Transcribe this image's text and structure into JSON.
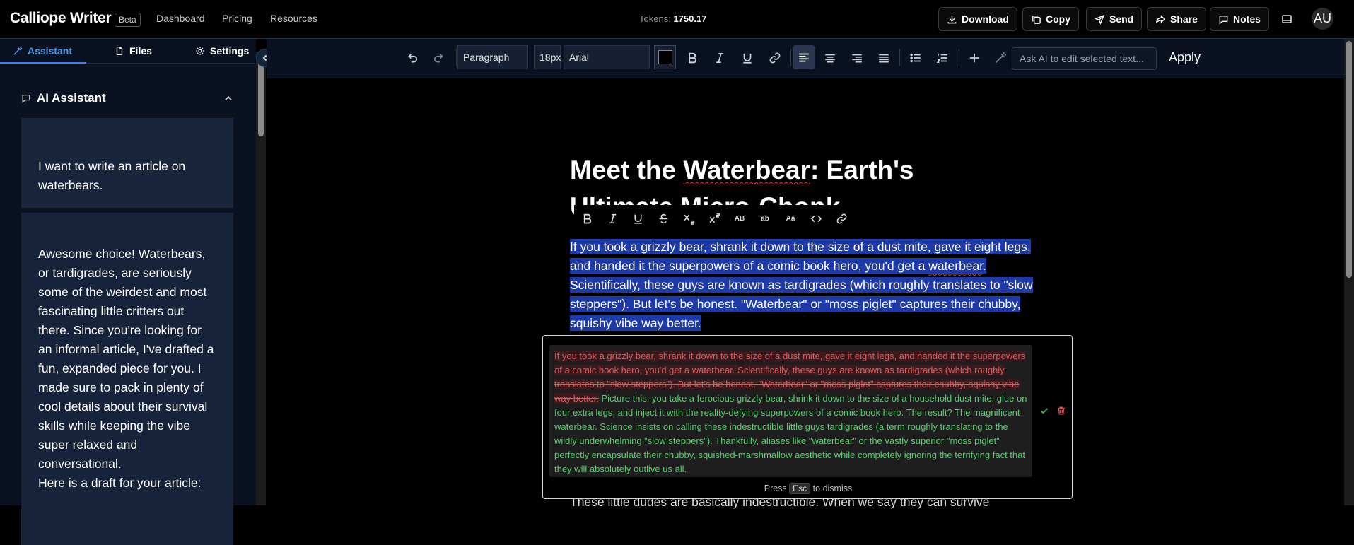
{
  "app": {
    "brand": "Calliope Writer",
    "badge": "Beta",
    "nav": [
      "Dashboard",
      "Pricing",
      "Resources"
    ],
    "tokens_label": "Tokens:",
    "tokens_value": "1750.17",
    "actions": {
      "download": "Download",
      "copy": "Copy",
      "send": "Send",
      "share": "Share",
      "notes": "Notes"
    },
    "avatar_initials": "AU"
  },
  "sidebar": {
    "tabs": [
      "Assistant",
      "Files",
      "Settings"
    ],
    "active_tab": "Assistant",
    "panel_title": "AI Assistant",
    "messages": [
      {
        "role": "user",
        "text": "I want to write an article on waterbears."
      },
      {
        "role": "assistant",
        "text": "Awesome choice! Waterbears, or tardigrades, are seriously some of the weirdest and most fascinating little critters out there. Since you're looking for an informal article, I've drafted a fun, expanded piece for you. I made sure to pack in plenty of cool details about their survival skills while keeping the vibe super relaxed and conversational.",
        "text2": "Here is a draft for your article:"
      }
    ]
  },
  "toolbar": {
    "block_type": "Paragraph",
    "font_size": "18px",
    "font_family": "Arial",
    "text_color": "#000000",
    "ai_placeholder": "Ask AI to edit selected text...",
    "apply_label": "Apply"
  },
  "editor": {
    "title_p1": "Meet the ",
    "title_squig": "Waterbear",
    "title_p2": ": Earth's Ultimate Micro-Chonk",
    "para_p1": "If you took a grizzly bear, shrank it down to the size of a dust mite, gave it eight legs, and handed it the superpowers of a comic book hero, you'd get a ",
    "para_squig": "waterbear",
    "para_p2": ". Scientifically, these guys are known as tardigrades (which roughly translates to \"slow steppers\"). But let's be honest. \"Waterbear\" or \"moss piglet\" captures their chubby, squishy vibe way better.",
    "next_line": "These little dudes are basically indestructible. When we say they can survive"
  },
  "float_toolbar": {
    "superscript_like": [
      "AB",
      "ab",
      "Aa"
    ]
  },
  "diff": {
    "deleted": "If you took a grizzly bear, shrank it down to the size of a dust mite, gave it eight legs, and handed it the superpowers of a comic book hero, you'd get a waterbear. Scientifically, these guys are known as tardigrades (which roughly translates to \"slow steppers\"). But let's be honest. \"Waterbear\" or \"moss piglet\" captures their chubby, squishy vibe way better.",
    "inserted": "Picture this: you take a ferocious grizzly bear, shrink it down to the size of a household dust mite, glue on four extra legs, and inject it with the reality-defying superpowers of a comic book hero. The result? The magnificent waterbear. Science insists on calling these indestructible little guys tardigrades (a term roughly translating to the wildly underwhelming \"slow steppers\"). Thankfully, aliases like \"waterbear\" or the vastly superior \"moss piglet\" perfectly encapsulate their chubby, squished-marshmallow aesthetic while completely ignoring the terrifying fact that they will absolutely outlive us all.",
    "hint_pre": "Press",
    "hint_key": "Esc",
    "hint_post": "to dismiss"
  },
  "colors": {
    "accent": "#3b82f6",
    "selection": "#1e3aa8",
    "deleted": "#e05a5a",
    "inserted": "#4fd26a",
    "sidebar_bg": "#0a1222"
  }
}
